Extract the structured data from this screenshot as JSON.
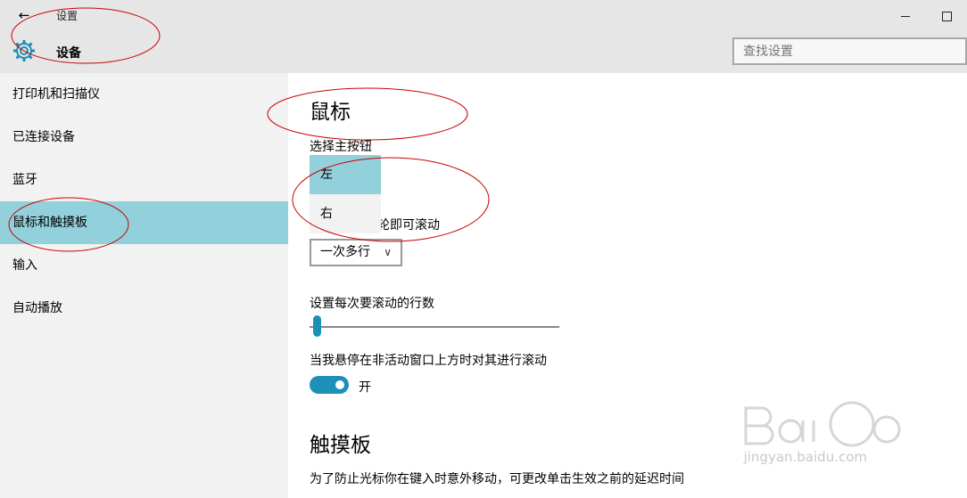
{
  "window": {
    "title": "设置"
  },
  "header": {
    "title": "设备",
    "search": {
      "placeholder": "查找设置"
    }
  },
  "sidebar": {
    "items": [
      {
        "label": "打印机和扫描仪",
        "active": false
      },
      {
        "label": "已连接设备",
        "active": false
      },
      {
        "label": "蓝牙",
        "active": false
      },
      {
        "label": "鼠标和触摸板",
        "active": true
      },
      {
        "label": "输入",
        "active": false
      },
      {
        "label": "自动播放",
        "active": false
      }
    ]
  },
  "main": {
    "mouse_heading": "鼠标",
    "primary_button": {
      "label": "选择主按钮",
      "options": [
        "左",
        "右"
      ],
      "selected": "左"
    },
    "scroll_label_visible": "轮即可滚动",
    "scroll_mode": {
      "value": "一次多行"
    },
    "lines_label": "设置每次要滚动的行数",
    "lines_slider": {
      "value_fraction": 0.03
    },
    "inactive_scroll": {
      "label": "当我悬停在非活动窗口上方时对其进行滚动",
      "state": "开",
      "on": true
    },
    "touchpad_heading": "触摸板",
    "touchpad_desc": "为了防止光标你在键入时意外移动，可更改单击生效之前的延迟时间"
  },
  "watermark": {
    "text": "jingyan.baidu.com"
  },
  "colors": {
    "accent": "#1d8fb8",
    "selection": "#92d0dc",
    "annotation": "#cc0000"
  }
}
